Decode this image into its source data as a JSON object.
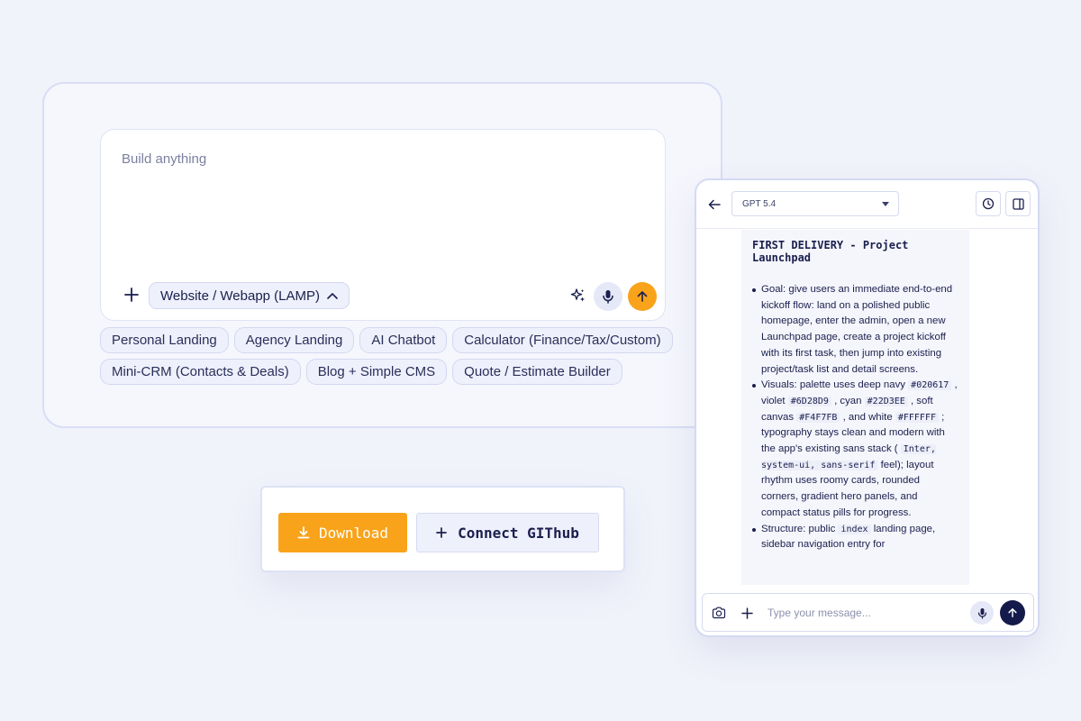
{
  "builder": {
    "prompt_placeholder": "Build anything",
    "stack_select": "Website / Webapp (LAMP)",
    "chips_row1": [
      "Personal Landing",
      "Agency Landing",
      "AI Chatbot",
      "Calculator (Finance/Tax/Custom)"
    ],
    "chips_row2": [
      "Mini-CRM (Contacts & Deals)",
      "Blog + Simple CMS",
      "Quote / Estimate Builder"
    ],
    "icons": [
      "plus-icon",
      "chevron-up-icon",
      "sparkle-icon",
      "mic-icon",
      "arrow-up-icon"
    ]
  },
  "actions": {
    "download_label": "Download",
    "github_label": "Connect GIThub"
  },
  "chat": {
    "model": "GPT 5.4",
    "title": "FIRST DELIVERY - Project Launchpad",
    "bullets": {
      "goal": "Goal: give users an immediate end-to-end kickoff flow: land on a polished public homepage, enter the admin, open a new Launchpad page, create a project kickoff with its first task, then jump into existing project/task list and detail screens.",
      "visuals_a": "Visuals: palette uses deep navy ",
      "c1": "#020617",
      "visuals_b": " , violet ",
      "c2": "#6D28D9",
      "visuals_c": " , cyan ",
      "c3": "#22D3EE",
      "visuals_d": " , soft canvas ",
      "c4": "#F4F7FB",
      "visuals_e": " , and white ",
      "c5": "#FFFFFF",
      "visuals_f": " ; typography stays clean and modern with the app's existing sans stack ( ",
      "c6": "Inter, system-ui, sans-serif",
      "visuals_g": " feel); layout rhythm uses roomy cards, rounded corners, gradient hero panels, and compact status pills for progress.",
      "structure_a": "Structure: public ",
      "c7": "index",
      "structure_b": " landing page, sidebar navigation entry for"
    },
    "input_placeholder": "Type your message...",
    "accent": "#141a4a"
  },
  "colors": {
    "orange": "#f9a31a",
    "navy": "#1a1f4d",
    "background": "#f1f3fb"
  }
}
